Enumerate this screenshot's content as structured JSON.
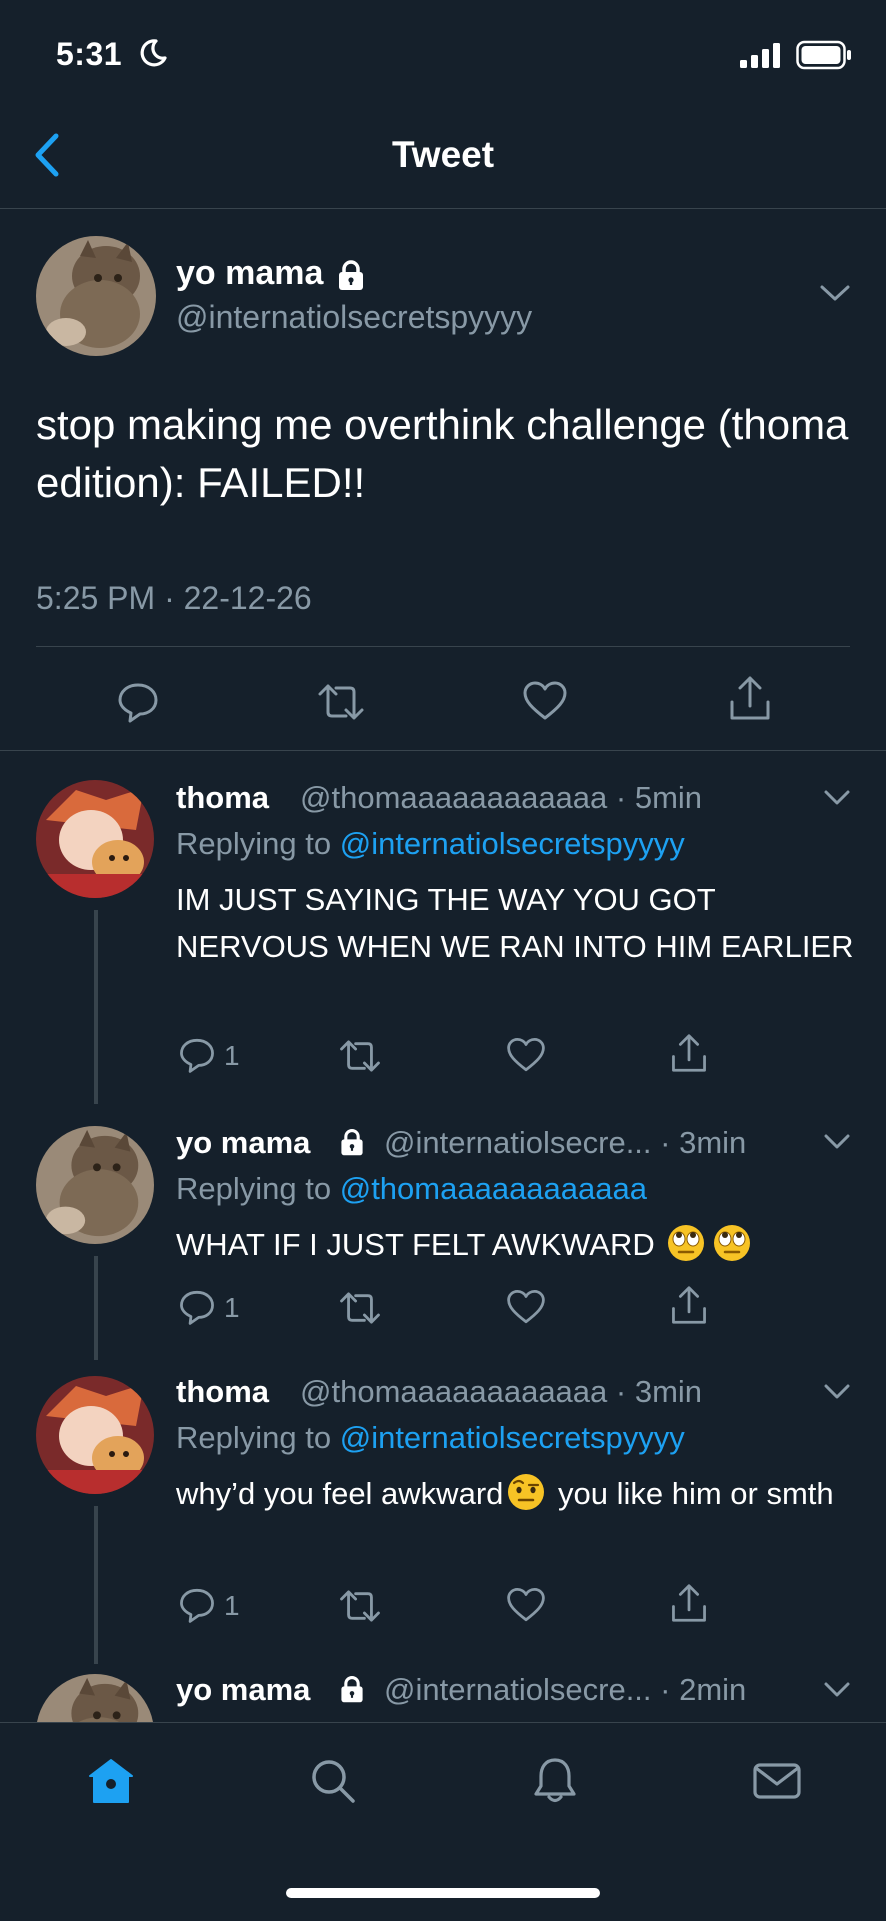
{
  "status_bar": {
    "time": "5:31"
  },
  "header": {
    "title": "Tweet"
  },
  "main_tweet": {
    "name": "yo mama",
    "handle": "@internatiolsecretspyyyy",
    "text": "stop making me overthink challenge (thoma edition): FAILED!!",
    "timestamp": "5:25 PM · 22-12-26"
  },
  "replies": [
    {
      "name": "thoma",
      "handle": "@thomaaaaaaaaaaaa",
      "time": "· 5min",
      "replying_label": "Replying to",
      "replying_to": "@internatiolsecretspyyyy",
      "text": "IM JUST SAYING THE WAY YOU GOT NERVOUS WHEN WE RAN INTO HIM EARLIER",
      "reply_count": "1"
    },
    {
      "name": "yo mama",
      "handle": "@internatiolsecre...",
      "time": "· 3min",
      "replying_label": "Replying to",
      "replying_to": "@thomaaaaaaaaaaaa",
      "text": "WHAT IF I JUST FELT AWKWARD",
      "emoji": [
        "rolling-eyes-emoji",
        "rolling-eyes-emoji"
      ],
      "reply_count": "1"
    },
    {
      "name": "thoma",
      "handle": "@thomaaaaaaaaaaaa",
      "time": "· 3min",
      "replying_label": "Replying to",
      "replying_to": "@internatiolsecretspyyyy",
      "text_before_emoji": "why’d you feel awkward",
      "emoji": [
        "raised-eyebrow-emoji"
      ],
      "text_after_emoji": " you like him or smth",
      "reply_count": "1"
    },
    {
      "name": "yo mama",
      "handle": "@internatiolsecre...",
      "time": "· 2min"
    }
  ],
  "colors": {
    "background": "#15202b",
    "accent": "#1da1f2",
    "secondary_text": "#8899a6",
    "divider": "#38444d"
  },
  "tab_bar": [
    "home-icon",
    "search-icon",
    "notifications-icon",
    "messages-icon"
  ]
}
